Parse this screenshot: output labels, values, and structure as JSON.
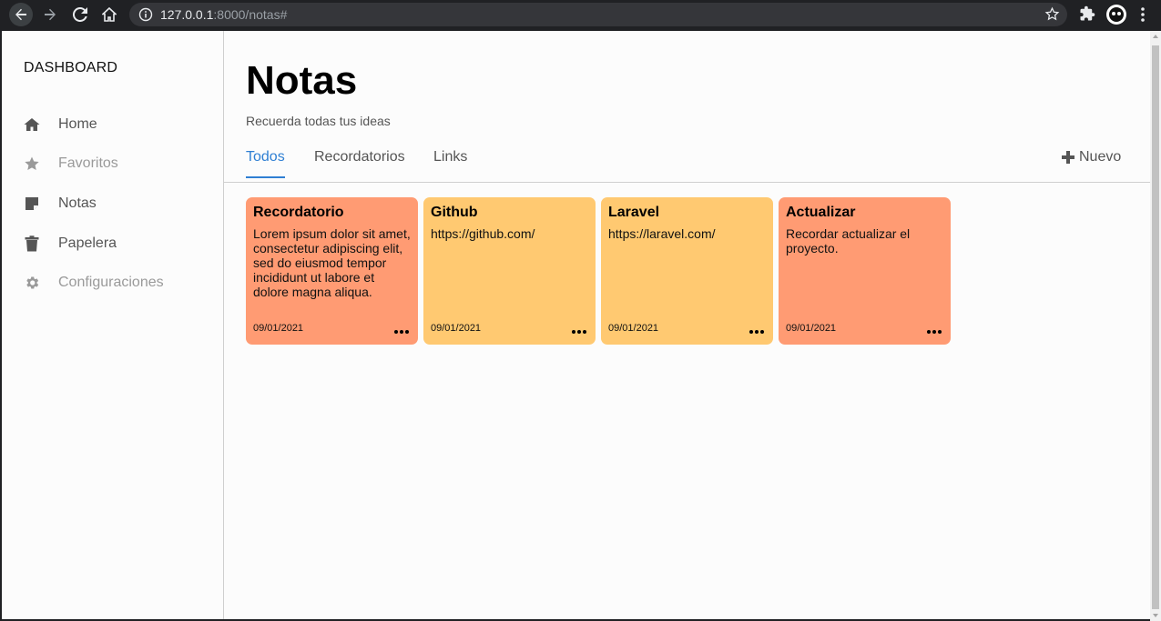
{
  "browser": {
    "url_host": "127.0.0.1",
    "url_rest": ":8000/notas#"
  },
  "sidebar": {
    "brand": "DASHBOARD",
    "items": [
      {
        "label": "Home",
        "icon": "home-icon"
      },
      {
        "label": "Favoritos",
        "icon": "star-icon"
      },
      {
        "label": "Notas",
        "icon": "note-icon"
      },
      {
        "label": "Papelera",
        "icon": "trash-icon"
      },
      {
        "label": "Configuraciones",
        "icon": "gear-icon"
      }
    ]
  },
  "main": {
    "title": "Notas",
    "subtitle": "Recuerda todas tus ideas",
    "tabs": [
      {
        "label": "Todos"
      },
      {
        "label": "Recordatorios"
      },
      {
        "label": "Links"
      }
    ],
    "new_label": "Nuevo"
  },
  "notes": [
    {
      "title": "Recordatorio",
      "body": "Lorem ipsum dolor sit amet, consectetur adipiscing elit, sed do eiusmod tempor incididunt ut labore et dolore magna aliqua.",
      "date": "09/01/2021",
      "color": "#ff9b73"
    },
    {
      "title": "Github",
      "body": "https://github.com/",
      "date": "09/01/2021",
      "color": "#ffc971"
    },
    {
      "title": "Laravel",
      "body": "https://laravel.com/",
      "date": "09/01/2021",
      "color": "#ffc971"
    },
    {
      "title": "Actualizar",
      "body": "Recordar actualizar el proyecto.",
      "date": "09/01/2021",
      "color": "#ff9b73"
    }
  ],
  "colors": {
    "accent": "#2f7fd3",
    "orange_note": "#ff9b73",
    "yellow_note": "#ffc971"
  }
}
